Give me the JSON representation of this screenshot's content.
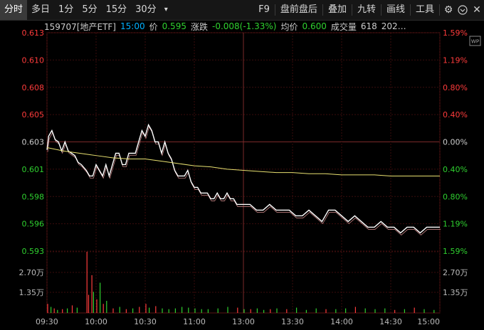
{
  "toolbar": {
    "tabs": [
      "分时",
      "多日",
      "1分",
      "5分",
      "15分",
      "30分"
    ],
    "active_tab": 0,
    "dropdown_glyph": "▾",
    "right_buttons": [
      "F9",
      "盘前盘后",
      "叠加",
      "九转",
      "画线",
      "工具"
    ],
    "icons": [
      "gear-icon",
      "circle-chevron-down-icon",
      "close-icon"
    ]
  },
  "info": {
    "code_name": "159707[地产ETF]",
    "time": "15:00",
    "price_label": "价",
    "price": "0.595",
    "change_label": "涨跌",
    "change": "-0.008(-1.33%)",
    "avg_label": "均价",
    "avg": "0.600",
    "volume_label": "成交量",
    "volume": "618",
    "extra": "202…",
    "wp_badge": "WP"
  },
  "colors": {
    "up": "#ff3b3b",
    "down": "#2fd02f",
    "neutral": "#cccccc",
    "price_line": "#ffffff",
    "avg_line": "#e8e070",
    "accent": "#00b0ff",
    "grid": "#3a0a0a"
  },
  "chart_data": {
    "type": "line",
    "prev_close": 0.603,
    "price_ticks": [
      "0.613",
      "0.610",
      "0.608",
      "0.605",
      "0.603",
      "0.601",
      "0.598",
      "0.596",
      "0.593"
    ],
    "pct_ticks": [
      "1.59%",
      "1.19%",
      "0.80%",
      "0.40%",
      "0.00%",
      "0.40%",
      "0.80%",
      "1.19%",
      "1.59%"
    ],
    "volume_ticks": [
      "2.70万",
      "1.35万"
    ],
    "x_ticks": [
      "09:30",
      "10:00",
      "10:30",
      "11:00",
      "13:00",
      "13:30",
      "14:00",
      "14:30",
      "15:00"
    ],
    "ylim": [
      0.5934,
      0.6126
    ],
    "volume_max": 40500,
    "series": [
      {
        "role": "price",
        "x": [
          0,
          1,
          3,
          5,
          7,
          9,
          11,
          13,
          15,
          17,
          19,
          21,
          24,
          26,
          28,
          30,
          32,
          34,
          36,
          38,
          40,
          42,
          44,
          46,
          48,
          50,
          52,
          54,
          56,
          58,
          60,
          62,
          64,
          66,
          68,
          70,
          72,
          74,
          76,
          78,
          80,
          82,
          84,
          86,
          88,
          90,
          92,
          94,
          96,
          98,
          100,
          102,
          104,
          106,
          108,
          110,
          112,
          114,
          116,
          118,
          120,
          124,
          128,
          132,
          136,
          140,
          144,
          148,
          152,
          156,
          160,
          164,
          168,
          172,
          176,
          180,
          184,
          188,
          192,
          196,
          200,
          204,
          208,
          212,
          216,
          220,
          224,
          228,
          232,
          236,
          240
        ],
        "values": [
          0.6023,
          0.6035,
          0.604,
          0.6032,
          0.603,
          0.6022,
          0.603,
          0.6022,
          0.602,
          0.6018,
          0.6012,
          0.601,
          0.6005,
          0.6,
          0.6,
          0.601,
          0.6005,
          0.6,
          0.601,
          0.6,
          0.601,
          0.602,
          0.602,
          0.601,
          0.601,
          0.602,
          0.602,
          0.602,
          0.603,
          0.604,
          0.6035,
          0.6045,
          0.604,
          0.603,
          0.603,
          0.602,
          0.603,
          0.602,
          0.6015,
          0.6005,
          0.6,
          0.6,
          0.6,
          0.6005,
          0.5995,
          0.599,
          0.599,
          0.5985,
          0.5985,
          0.5985,
          0.598,
          0.598,
          0.5985,
          0.598,
          0.598,
          0.5985,
          0.598,
          0.598,
          0.5975,
          0.5975,
          0.5975,
          0.5975,
          0.597,
          0.597,
          0.5975,
          0.597,
          0.597,
          0.597,
          0.5965,
          0.5965,
          0.597,
          0.5965,
          0.596,
          0.597,
          0.597,
          0.5965,
          0.596,
          0.5965,
          0.596,
          0.5955,
          0.5955,
          0.596,
          0.5955,
          0.5955,
          0.595,
          0.5955,
          0.5955,
          0.595,
          0.5955,
          0.5955,
          0.5955
        ]
      },
      {
        "role": "average",
        "x": [
          0,
          10,
          20,
          30,
          40,
          50,
          60,
          70,
          80,
          90,
          100,
          110,
          120,
          130,
          140,
          150,
          160,
          170,
          180,
          190,
          200,
          210,
          220,
          230,
          240
        ],
        "values": [
          0.6025,
          0.6022,
          0.602,
          0.6018,
          0.6016,
          0.6015,
          0.6015,
          0.6013,
          0.6011,
          0.6009,
          0.6008,
          0.6006,
          0.6005,
          0.6004,
          0.6003,
          0.6003,
          0.6002,
          0.6002,
          0.6001,
          0.6001,
          0.6001,
          0.6,
          0.6,
          0.6,
          0.6
        ]
      }
    ],
    "volume": [
      [
        0,
        6000,
        "up"
      ],
      [
        2,
        4000,
        "down"
      ],
      [
        4,
        3000,
        "up"
      ],
      [
        6,
        2000,
        "down"
      ],
      [
        9,
        2500,
        "up"
      ],
      [
        12,
        3000,
        "down"
      ],
      [
        15,
        5000,
        "up"
      ],
      [
        18,
        3500,
        "down"
      ],
      [
        24,
        40500,
        "up"
      ],
      [
        25,
        12000,
        "up"
      ],
      [
        27,
        25000,
        "up"
      ],
      [
        28,
        14000,
        "down"
      ],
      [
        30,
        9000,
        "up"
      ],
      [
        32,
        20000,
        "down"
      ],
      [
        34,
        6000,
        "up"
      ],
      [
        36,
        8000,
        "down"
      ],
      [
        40,
        3000,
        "up"
      ],
      [
        44,
        4000,
        "down"
      ],
      [
        48,
        2500,
        "up"
      ],
      [
        52,
        3000,
        "down"
      ],
      [
        56,
        4000,
        "up"
      ],
      [
        60,
        6000,
        "up"
      ],
      [
        62,
        3500,
        "down"
      ],
      [
        66,
        4500,
        "up"
      ],
      [
        70,
        3000,
        "down"
      ],
      [
        74,
        2500,
        "down"
      ],
      [
        78,
        3000,
        "down"
      ],
      [
        82,
        4000,
        "down"
      ],
      [
        86,
        3500,
        "down"
      ],
      [
        90,
        3000,
        "down"
      ],
      [
        94,
        2500,
        "down"
      ],
      [
        98,
        2500,
        "down"
      ],
      [
        104,
        3000,
        "down"
      ],
      [
        110,
        4000,
        "down"
      ],
      [
        116,
        3500,
        "up"
      ],
      [
        120,
        2500,
        "down"
      ],
      [
        124,
        2500,
        "up"
      ],
      [
        128,
        3000,
        "down"
      ],
      [
        132,
        2000,
        "down"
      ],
      [
        136,
        2500,
        "up"
      ],
      [
        140,
        3000,
        "down"
      ],
      [
        146,
        2500,
        "up"
      ],
      [
        152,
        3500,
        "down"
      ],
      [
        158,
        2000,
        "down"
      ],
      [
        164,
        3000,
        "down"
      ],
      [
        170,
        2500,
        "up"
      ],
      [
        176,
        2500,
        "down"
      ],
      [
        182,
        3000,
        "down"
      ],
      [
        188,
        4000,
        "up"
      ],
      [
        194,
        3000,
        "down"
      ],
      [
        200,
        2500,
        "down"
      ],
      [
        206,
        3000,
        "down"
      ],
      [
        212,
        2000,
        "up"
      ],
      [
        218,
        2500,
        "down"
      ],
      [
        224,
        3500,
        "up"
      ],
      [
        230,
        2500,
        "down"
      ],
      [
        236,
        2000,
        "down"
      ]
    ]
  }
}
